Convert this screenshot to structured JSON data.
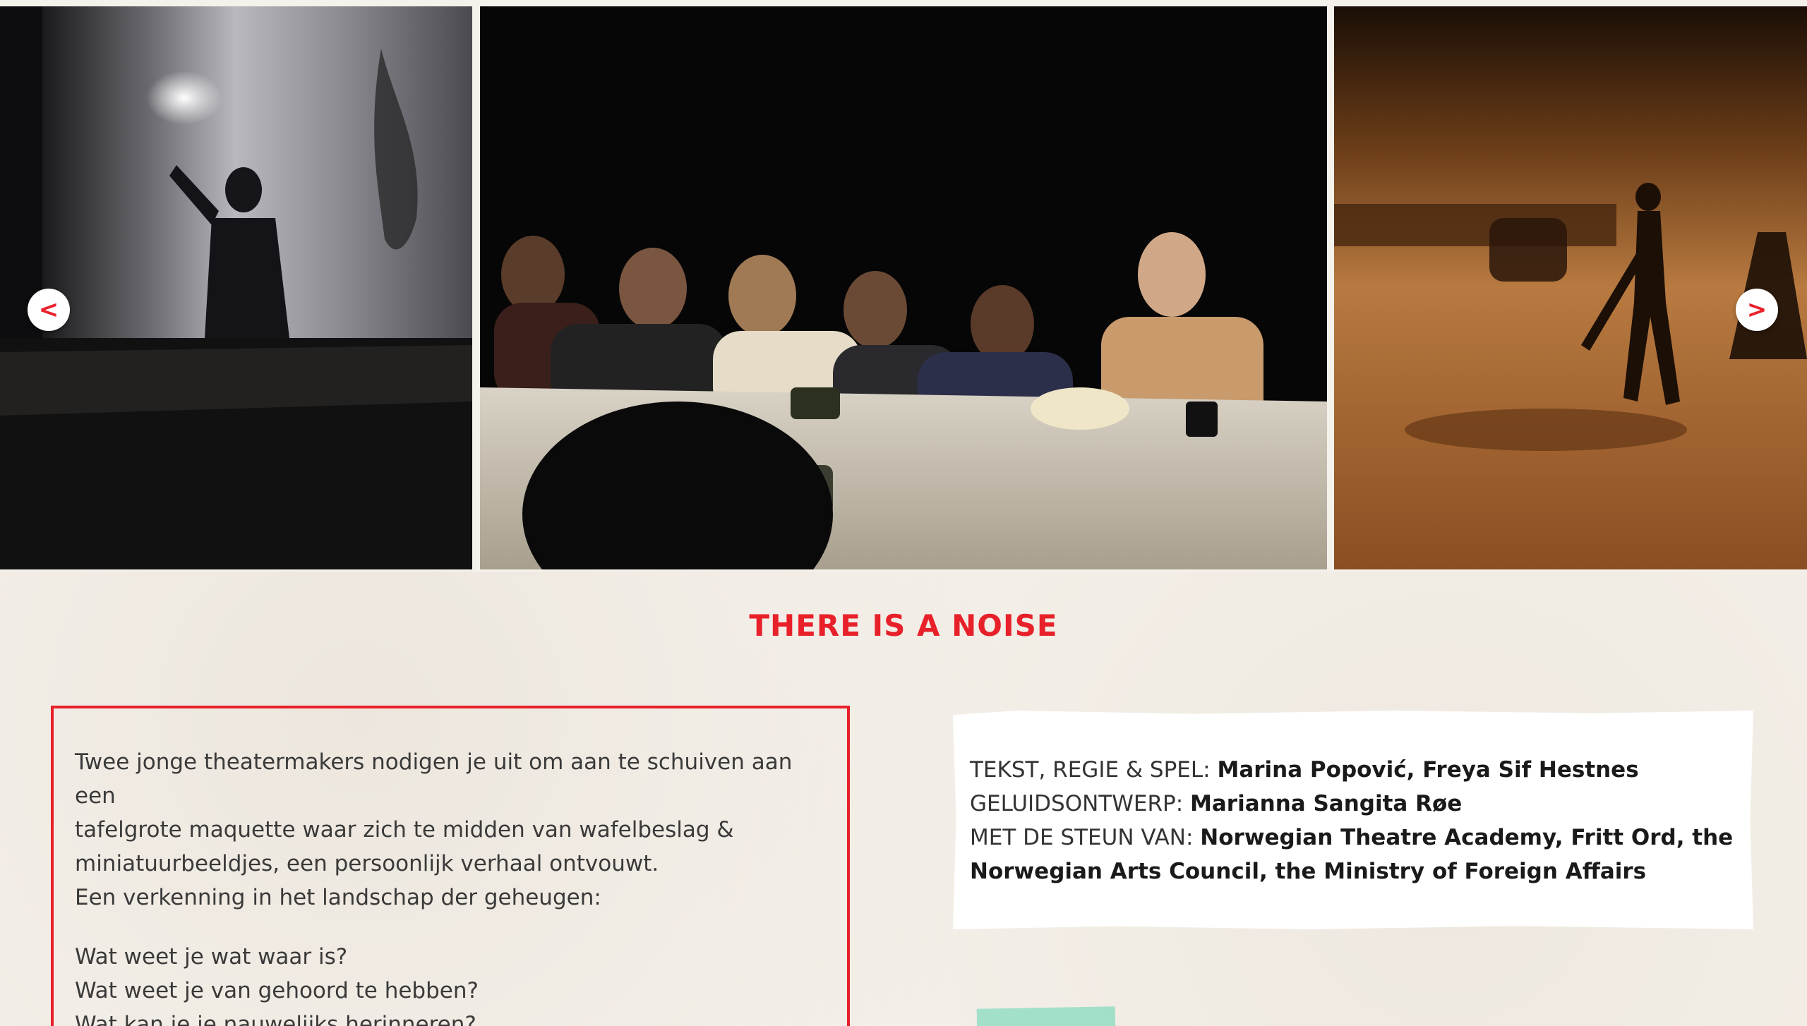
{
  "carousel": {
    "prev_label": "<",
    "next_label": ">"
  },
  "production": {
    "title": "THERE IS A NOISE"
  },
  "description": {
    "paragraph1": [
      "Twee jonge theatermakers nodigen je uit om aan te schuiven aan een",
      "tafelgrote maquette waar zich te midden van wafelbeslag &",
      "miniatuurbeeldjes, een persoonlijk verhaal ontvouwt.",
      "Een verkenning in het landschap der geheugen:"
    ],
    "paragraph2": [
      "Wat weet je wat waar is?",
      "Wat weet je van gehoord te hebben?",
      "Wat kan je je nauwelijks herinneren?"
    ]
  },
  "credits": [
    {
      "label": "TEKST, REGIE & SPEL:",
      "value": "Marina Popović, Freya Sif Hestnes"
    },
    {
      "label": "GELUIDSONTWERP:",
      "value": "Marianna Sangita Røe"
    },
    {
      "label": "MET DE STEUN VAN:",
      "value": "Norwegian Theatre Academy, Fritt Ord, the"
    },
    {
      "label": "",
      "value": "Norwegian Arts Council, the Ministry of Foreign Affairs"
    }
  ],
  "colors": {
    "accent": "#e8202a",
    "background": "#f5f1eb",
    "tape": "#8fdcc2"
  },
  "icons": {
    "prev": "chevron-left-icon",
    "next": "chevron-right-icon"
  }
}
